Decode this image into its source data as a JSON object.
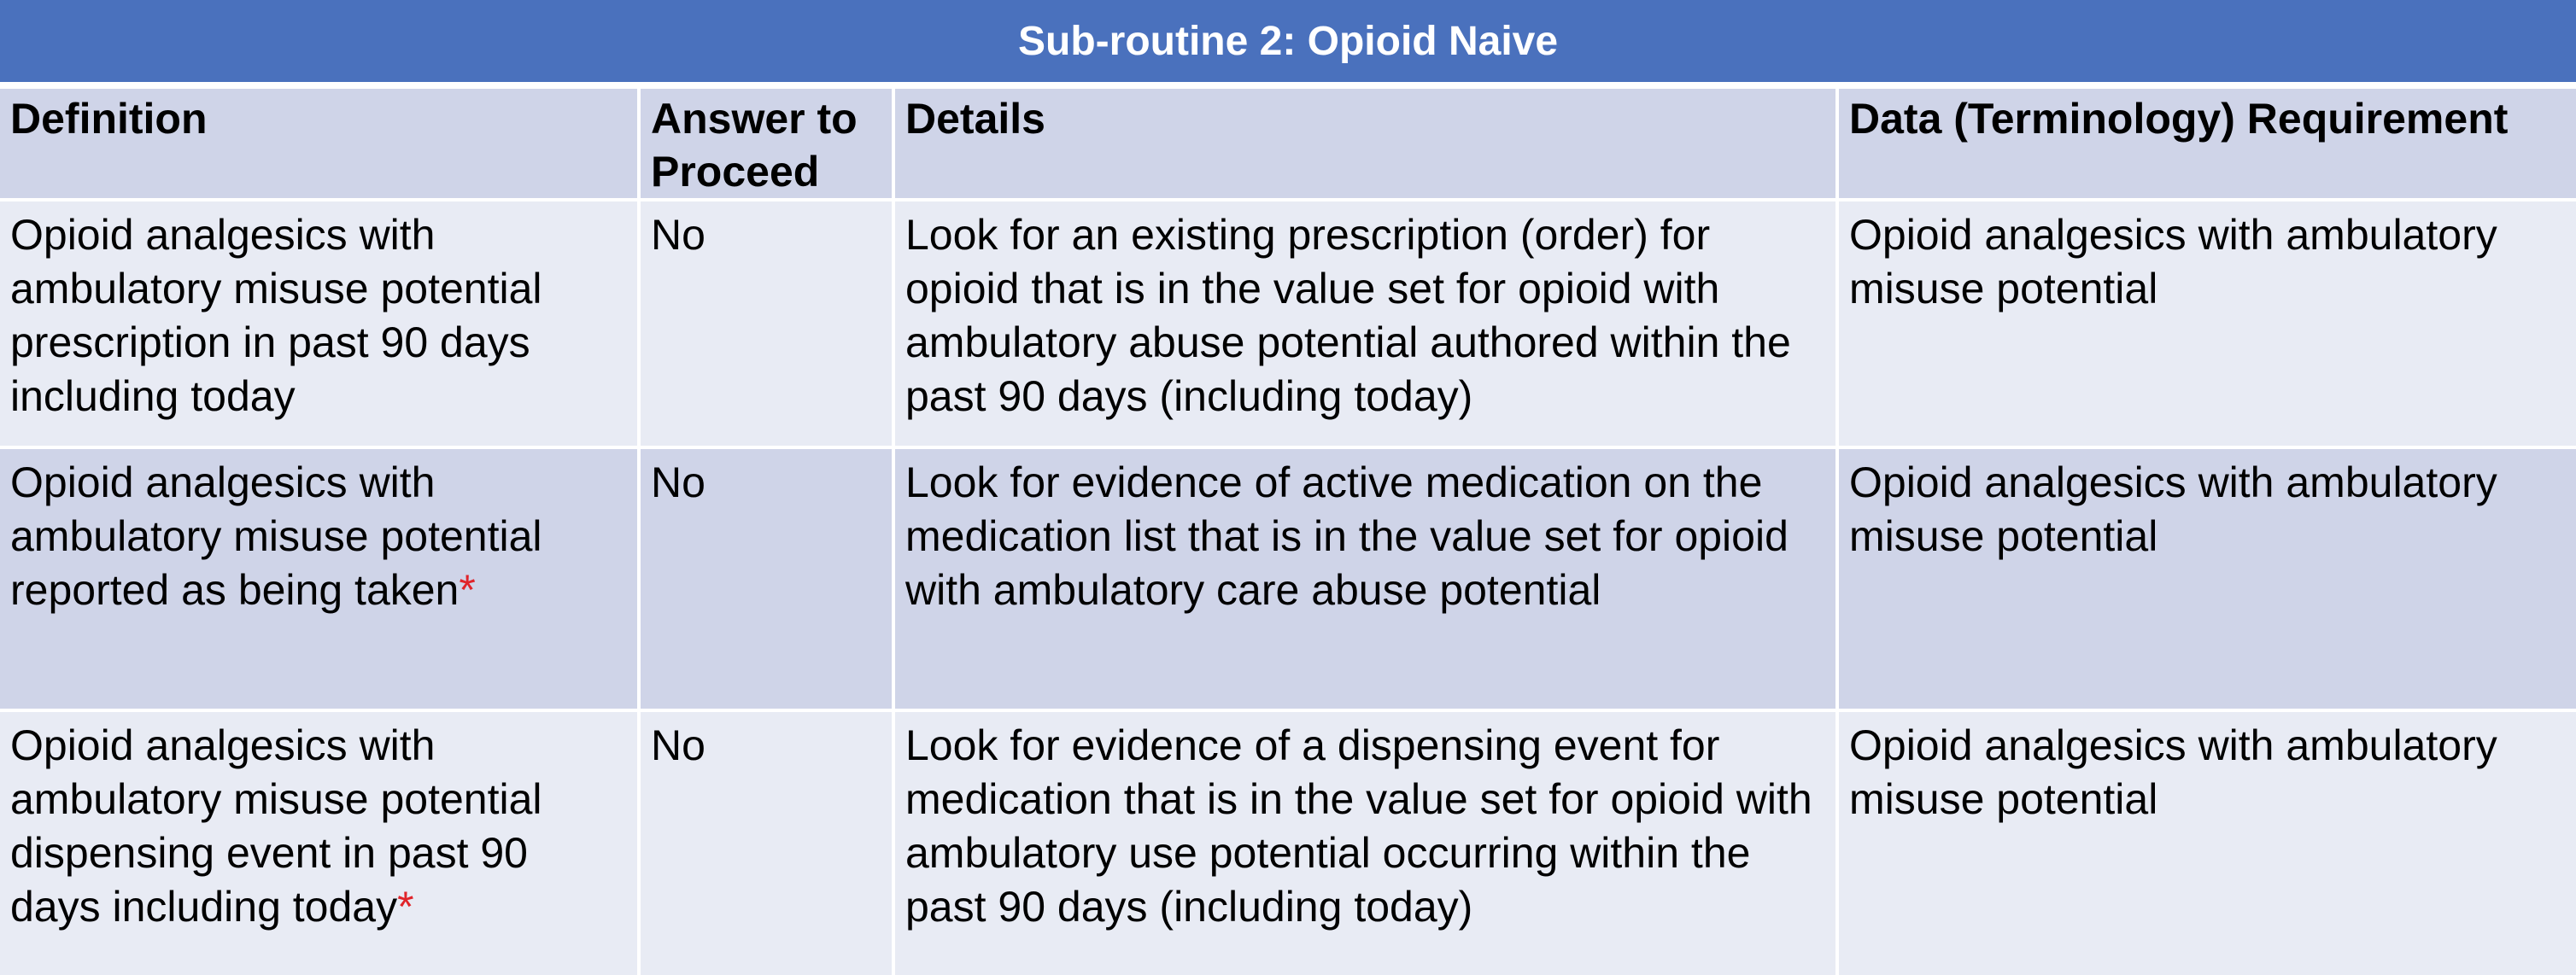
{
  "title": "Sub-routine 2: Opioid Naive",
  "columns": {
    "definition": "Definition",
    "answer": "Answer to Proceed",
    "details": "Details",
    "data_requirement": "Data (Terminology) Requirement"
  },
  "rows": [
    {
      "definition": "Opioid analgesics with ambulatory misuse potential prescription in past 90 days including today",
      "asterisk": "",
      "answer": "No",
      "details": "Look for an existing prescription (order) for opioid that is in the value set for opioid with ambulatory abuse potential authored within the past 90 days (including today)",
      "data_requirement": "Opioid analgesics with ambulatory misuse potential"
    },
    {
      "definition": "Opioid analgesics with ambulatory misuse potential reported as being taken",
      "asterisk": "*",
      "answer": "No",
      "details": "Look for evidence of active medication on the medication list that is in the value set for opioid with ambulatory care abuse potential",
      "data_requirement": "Opioid analgesics with ambulatory misuse potential"
    },
    {
      "definition": "Opioid analgesics with ambulatory misuse potential dispensing event in past 90 days including today",
      "asterisk": "*",
      "answer": "No",
      "details": "Look for evidence of a dispensing event for medication that is in the value set for opioid with ambulatory use potential occurring within the past 90 days (including today)",
      "data_requirement": "Opioid analgesics with ambulatory misuse potential"
    }
  ],
  "colors": {
    "title_bar": "#4a71bd",
    "header_row": "#cfd4e8",
    "row_light": "#e8ebf4",
    "row_dark": "#cfd4e8",
    "asterisk": "#e0242a"
  }
}
